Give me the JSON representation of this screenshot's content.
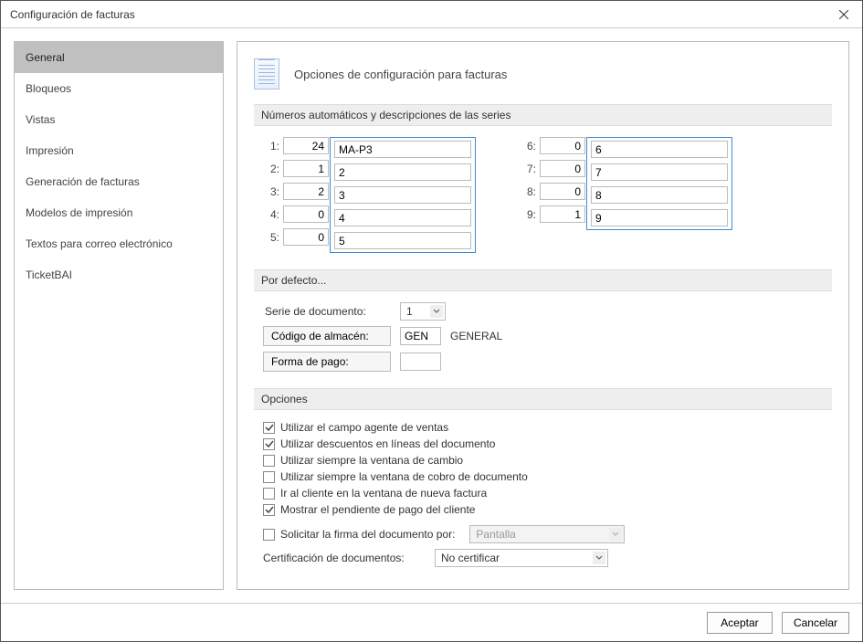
{
  "window": {
    "title": "Configuración de facturas"
  },
  "sidebar": {
    "items": [
      {
        "label": "General",
        "active": true
      },
      {
        "label": "Bloqueos",
        "active": false
      },
      {
        "label": "Vistas",
        "active": false
      },
      {
        "label": "Impresión",
        "active": false
      },
      {
        "label": "Generación de facturas",
        "active": false
      },
      {
        "label": "Modelos de impresión",
        "active": false
      },
      {
        "label": "Textos para correo electrónico",
        "active": false
      },
      {
        "label": "TicketBAI",
        "active": false
      }
    ]
  },
  "header": {
    "title": "Opciones de configuración para facturas"
  },
  "sections": {
    "series_header": "Números automáticos y descripciones de las series",
    "defaults_header": "Por defecto...",
    "options_header": "Opciones"
  },
  "series": {
    "left": [
      {
        "label": "1:",
        "num": "24",
        "desc": "MA-P3"
      },
      {
        "label": "2:",
        "num": "1",
        "desc": "2"
      },
      {
        "label": "3:",
        "num": "2",
        "desc": "3"
      },
      {
        "label": "4:",
        "num": "0",
        "desc": "4"
      },
      {
        "label": "5:",
        "num": "0",
        "desc": "5"
      }
    ],
    "right": [
      {
        "label": "6:",
        "num": "0",
        "desc": "6"
      },
      {
        "label": "7:",
        "num": "0",
        "desc": "7"
      },
      {
        "label": "8:",
        "num": "0",
        "desc": "8"
      },
      {
        "label": "9:",
        "num": "1",
        "desc": "9"
      }
    ]
  },
  "defaults": {
    "serie_label": "Serie de documento:",
    "serie_value": "1",
    "almacen_label": "Código de almacén:",
    "almacen_code": "GEN",
    "almacen_name": "GENERAL",
    "pago_label": "Forma de pago:",
    "pago_value": ""
  },
  "options": {
    "items": [
      {
        "label": "Utilizar el campo agente de ventas",
        "checked": true
      },
      {
        "label": "Utilizar descuentos en líneas del documento",
        "checked": true
      },
      {
        "label": "Utilizar siempre la ventana de cambio",
        "checked": false
      },
      {
        "label": "Utilizar siempre la ventana de cobro de documento",
        "checked": false
      },
      {
        "label": "Ir al cliente en la ventana de nueva factura",
        "checked": false
      },
      {
        "label": "Mostrar el pendiente de pago del cliente",
        "checked": true
      }
    ],
    "firma_label": "Solicitar la firma del documento por:",
    "firma_checked": false,
    "firma_value": "Pantalla",
    "cert_label": "Certificación de documentos:",
    "cert_value": "No certificar"
  },
  "footer": {
    "accept": "Aceptar",
    "cancel": "Cancelar"
  }
}
